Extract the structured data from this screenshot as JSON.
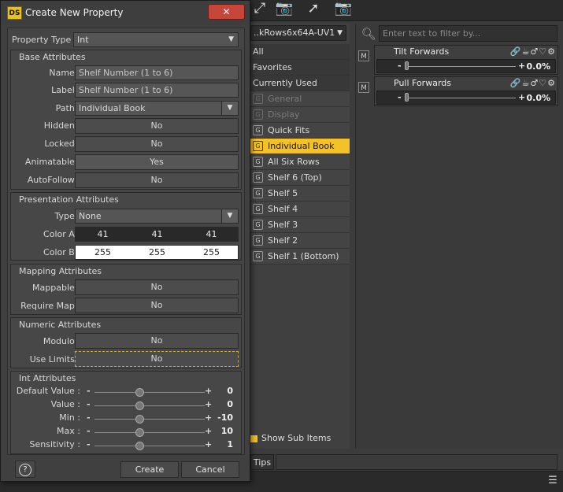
{
  "dialog": {
    "title": "Create New Property",
    "logo": "DS",
    "close": "✕",
    "property_type": {
      "label": "Property Type :",
      "value": "Int"
    },
    "base": {
      "title": "Base Attributes",
      "name": {
        "label": "Name :",
        "value": "Shelf Number (1 to 6)"
      },
      "label": {
        "label": "Label :",
        "value": "Shelf Number (1 to 6)"
      },
      "path": {
        "label": "Path :",
        "value": "Individual Book"
      },
      "hidden": {
        "label": "Hidden :",
        "value": "No"
      },
      "locked": {
        "label": "Locked :",
        "value": "No"
      },
      "animatable": {
        "label": "Animatable :",
        "value": "Yes"
      },
      "autofollow": {
        "label": "AutoFollow :",
        "value": "No"
      }
    },
    "presentation": {
      "title": "Presentation Attributes",
      "type": {
        "label": "Type :",
        "value": "None"
      },
      "color_a": {
        "label": "Color A :",
        "r": "41",
        "g": "41",
        "b": "41"
      },
      "color_b": {
        "label": "Color B :",
        "r": "255",
        "g": "255",
        "b": "255"
      }
    },
    "mapping": {
      "title": "Mapping Attributes",
      "mappable": {
        "label": "Mappable :",
        "value": "No"
      },
      "require_map": {
        "label": "Require Map :",
        "value": "No"
      }
    },
    "numeric": {
      "title": "Numeric Attributes",
      "modulo": {
        "label": "Modulo :",
        "value": "No"
      },
      "use_limits": {
        "label": "Use Limits :",
        "value": "No"
      }
    },
    "int_attrs": {
      "title": "Int Attributes",
      "rows": [
        {
          "label": "Default Value :",
          "value": "0"
        },
        {
          "label": "Value :",
          "value": "0"
        },
        {
          "label": "Min :",
          "value": "-10"
        },
        {
          "label": "Max :",
          "value": "10"
        },
        {
          "label": "Sensitivity :",
          "value": "1"
        }
      ]
    },
    "help": "?",
    "create": "Create",
    "cancel": "Cancel"
  },
  "groups": {
    "dropdown": "..kRows6x64A-UV1",
    "items": [
      {
        "label": "All"
      },
      {
        "label": "Favorites"
      },
      {
        "label": "Currently Used"
      },
      {
        "label": "General"
      },
      {
        "label": "Display"
      },
      {
        "label": "Quick Fits"
      },
      {
        "label": "Individual Book"
      },
      {
        "label": "All Six Rows"
      },
      {
        "label": "Shelf 6 (Top)"
      },
      {
        "label": "Shelf 5"
      },
      {
        "label": "Shelf 4"
      },
      {
        "label": "Shelf 3"
      },
      {
        "label": "Shelf 2"
      },
      {
        "label": "Shelf 1 (Bottom)"
      }
    ],
    "show_sub_items": "Show Sub Items",
    "tips": "Tips"
  },
  "properties": {
    "filter_placeholder": "Enter text to filter by...",
    "items": [
      {
        "badge": "M",
        "name": "Tilt Forwards",
        "value": "0.0%"
      },
      {
        "badge": "M",
        "name": "Pull Forwards",
        "value": "0.0%"
      }
    ]
  },
  "colors": {
    "accent": "#f3c229",
    "close": "#c7463a"
  }
}
